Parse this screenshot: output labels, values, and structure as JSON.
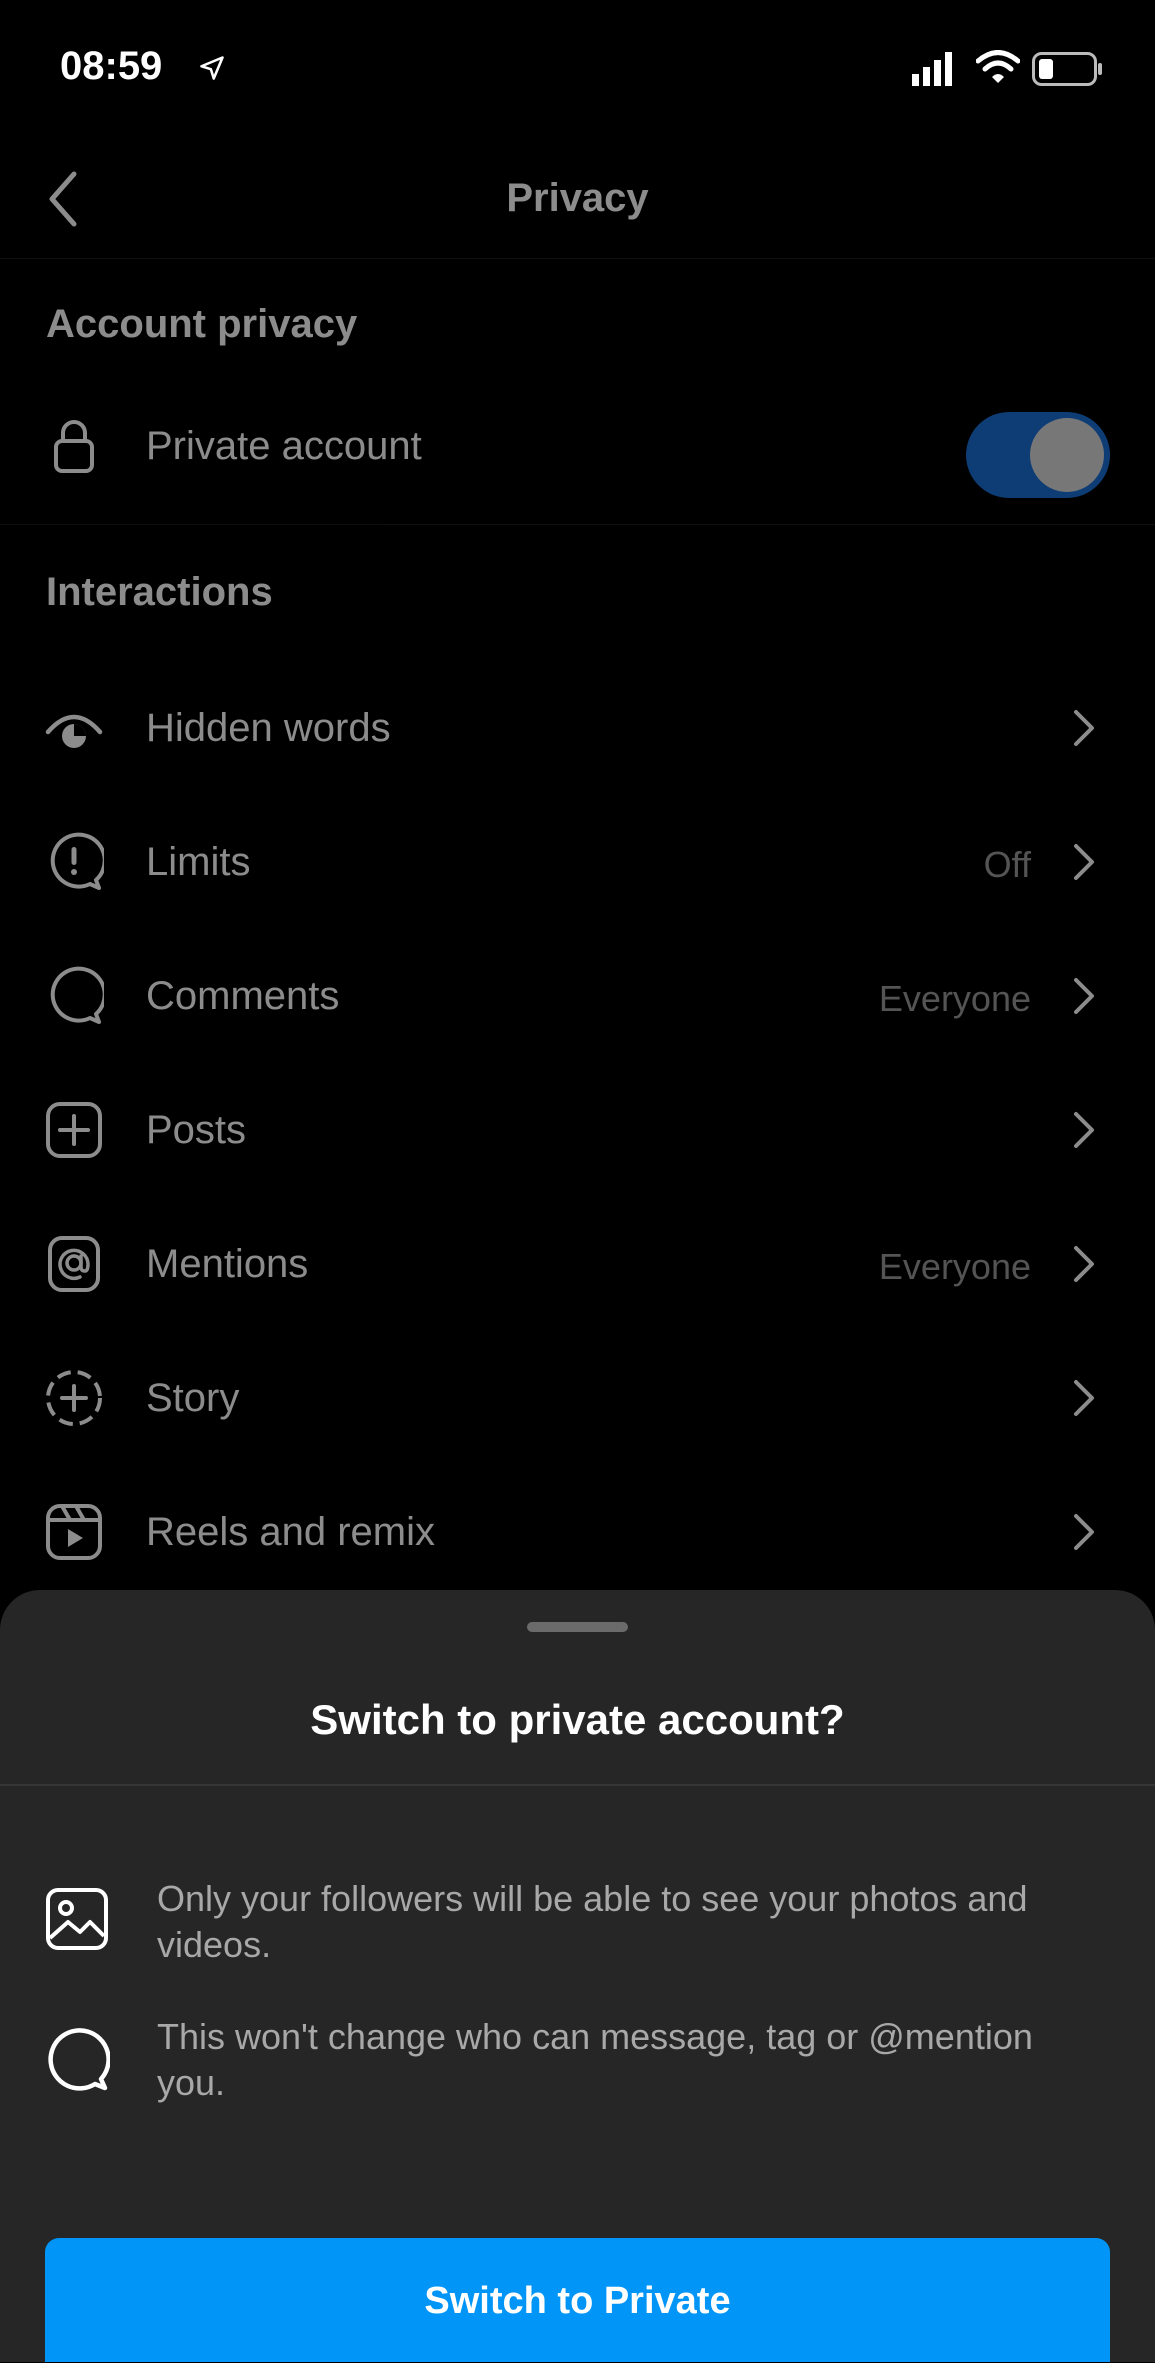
{
  "status_bar": {
    "time": "08:59",
    "icons": [
      "location-arrow-icon",
      "signal-icon",
      "wifi-icon",
      "battery-icon"
    ]
  },
  "header": {
    "title": "Privacy",
    "back_icon": "chevron-left-icon"
  },
  "account_privacy": {
    "heading": "Account privacy",
    "private_account": {
      "label": "Private account",
      "icon": "lock-icon",
      "toggle_on": true
    }
  },
  "interactions": {
    "heading": "Interactions",
    "items": [
      {
        "label": "Hidden words",
        "value": "",
        "icon": "hidden-words-eye-icon"
      },
      {
        "label": "Limits",
        "value": "Off",
        "icon": "limits-alert-bubble-icon"
      },
      {
        "label": "Comments",
        "value": "Everyone",
        "icon": "comment-bubble-icon"
      },
      {
        "label": "Posts",
        "value": "",
        "icon": "plus-square-icon"
      },
      {
        "label": "Mentions",
        "value": "Everyone",
        "icon": "at-sign-icon"
      },
      {
        "label": "Story",
        "value": "",
        "icon": "story-dashed-plus-icon"
      },
      {
        "label": "Reels and remix",
        "value": "",
        "icon": "reels-icon"
      }
    ]
  },
  "sheet": {
    "title": "Switch to private account?",
    "items": [
      {
        "text": "Only your followers will be able to see your photos and videos.",
        "icon": "photo-icon"
      },
      {
        "text": "This won't change who can message, tag or @mention you.",
        "icon": "comment-bubble-icon"
      }
    ],
    "button_label": "Switch to Private"
  },
  "colors": {
    "accent": "#0095f6",
    "toggle": "#1a6fd6",
    "sheet": "#262626",
    "background": "#000000"
  }
}
